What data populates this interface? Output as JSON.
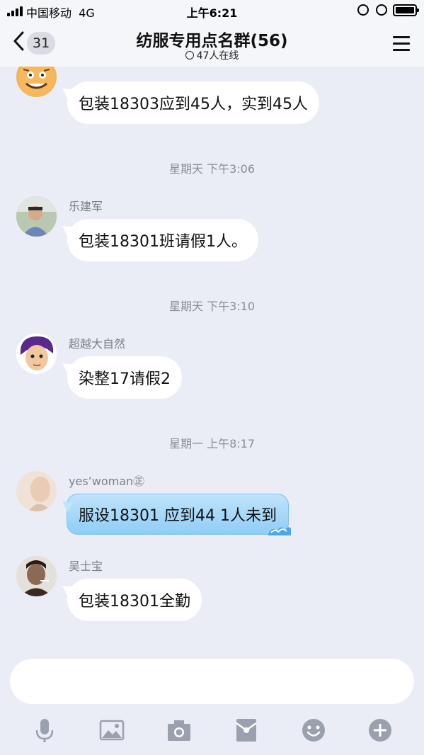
{
  "status_bar": {
    "carrier": "中国移动",
    "network": "4G",
    "time": "上午6:21"
  },
  "nav": {
    "unread_count": "31",
    "title": "纺服专用点名群(56)",
    "subtitle": "47人在线"
  },
  "messages": [
    {
      "sender": "",
      "text": "包装18303应到45人，实到45人",
      "avatar": "tiger-avatar"
    },
    {
      "timestamp": "星期天 下午3:06"
    },
    {
      "sender": "乐建军",
      "text": "包装18301班请假1人。",
      "avatar": "photo-avatar"
    },
    {
      "timestamp": "星期天 下午3:10"
    },
    {
      "sender": "超越大自然",
      "text": "染整17请假2",
      "avatar": "cartoon-avatar"
    },
    {
      "timestamp": "星期一 上午8:17"
    },
    {
      "sender": "yes’woman㊣",
      "text": "服设18301 应到44 1人未到",
      "avatar": "photo-avatar"
    },
    {
      "sender": "吴士宝",
      "text": "包装18301全勤",
      "avatar": "photo-avatar"
    }
  ],
  "ts1": "星期天 下午3:06",
  "ts2": "星期天 下午3:10",
  "ts3": "星期一 上午8:17",
  "m0": {
    "text": "包装18303应到45人，实到45人"
  },
  "m1": {
    "sender": "乐建军",
    "text": "包装18301班请假1人。"
  },
  "m2": {
    "sender": "超越大自然",
    "text": "染整17请假2"
  },
  "m3": {
    "sender": "yes’woman㊣",
    "text": "服设18301 应到44 1人未到"
  },
  "m4": {
    "sender": "吴士宝",
    "text": "包装18301全勤"
  },
  "toolbar": {
    "icons": [
      "microphone-icon",
      "image-icon",
      "camera-icon",
      "red-packet-icon",
      "emoji-icon",
      "plus-icon"
    ]
  },
  "colors": {
    "background": "#eaedf5",
    "bar": "#f5f6fa",
    "bubble": "#ffffff",
    "blue_bubble": "#8fcdf6",
    "toolbar_icon": "#9aa0ad"
  }
}
